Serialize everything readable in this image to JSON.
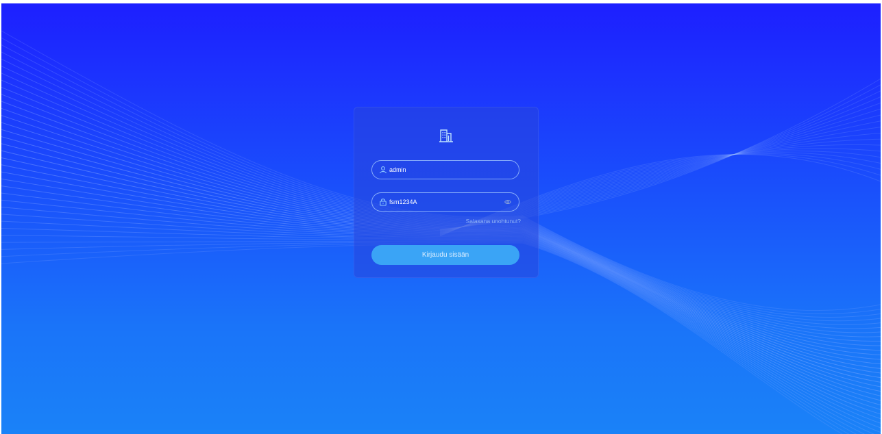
{
  "login": {
    "logo_icon": "building-icon",
    "username": {
      "icon": "user-icon",
      "value": "admin"
    },
    "password": {
      "icon": "lock-icon",
      "value": "fsm1234A",
      "toggle_icon": "eye-icon"
    },
    "forgot_password": "Salasana unohtunut?",
    "submit_label": "Kirjaudu sisään"
  },
  "colors": {
    "background_top": "#1d1fff",
    "background_bottom": "#1a82f8",
    "card": "#2846dc",
    "button": "#3aa4f6",
    "link": "#8fb2f5",
    "accent_icon": "#bfe3ff"
  }
}
